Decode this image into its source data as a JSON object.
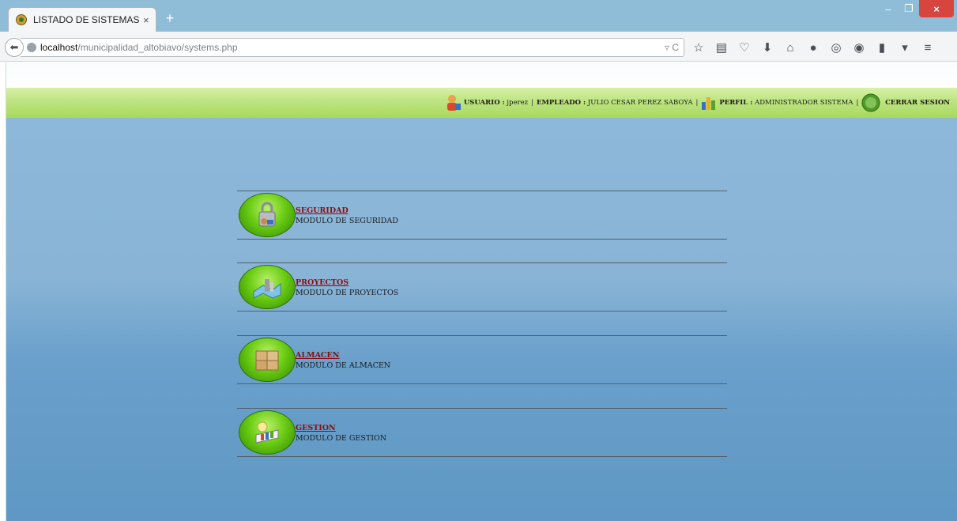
{
  "browser": {
    "tab_title": "LISTADO DE SISTEMAS",
    "tab_close": "×",
    "new_tab": "+",
    "window_buttons": {
      "minimize": "–",
      "maximize": "❐",
      "close": "×"
    },
    "url_host": "localhost",
    "url_path": "/municipalidad_altobiavo/systems.php",
    "url_controls": "▿ C",
    "icons": [
      "star-icon",
      "reading-list-icon",
      "pocket-icon",
      "download-icon",
      "home-icon",
      "chat-icon",
      "sync-icon",
      "addon-icon",
      "phone-icon",
      "dropdown-icon",
      "menu-icon"
    ]
  },
  "header": {
    "usuario_label": "USUARIO :",
    "usuario_value": "jperez",
    "empleado_label": "EMPLEADO :",
    "empleado_value": "JULIO CESAR PEREZ SABOYA",
    "perfil_label": "PERFIL :",
    "perfil_value": "ADMINISTRADOR SISTEMA",
    "separator": "|",
    "logout_label": "CERRAR SESION"
  },
  "modules": [
    {
      "title": "SEGURIDAD",
      "description": "MODULO DE SEGURIDAD",
      "icon": "padlock-icon"
    },
    {
      "title": "PROYECTOS",
      "description": "MODULO DE PROYECTOS",
      "icon": "map-icon"
    },
    {
      "title": "ALMACEN",
      "description": "MODULO DE ALMACEN",
      "icon": "boxes-icon"
    },
    {
      "title": "GESTION",
      "description": "MODULO DE GESTION",
      "icon": "chart-icon"
    }
  ],
  "colors": {
    "header_green": "#bfe584",
    "page_blue": "#7aabd2",
    "module_title": "#8b0d0d"
  }
}
